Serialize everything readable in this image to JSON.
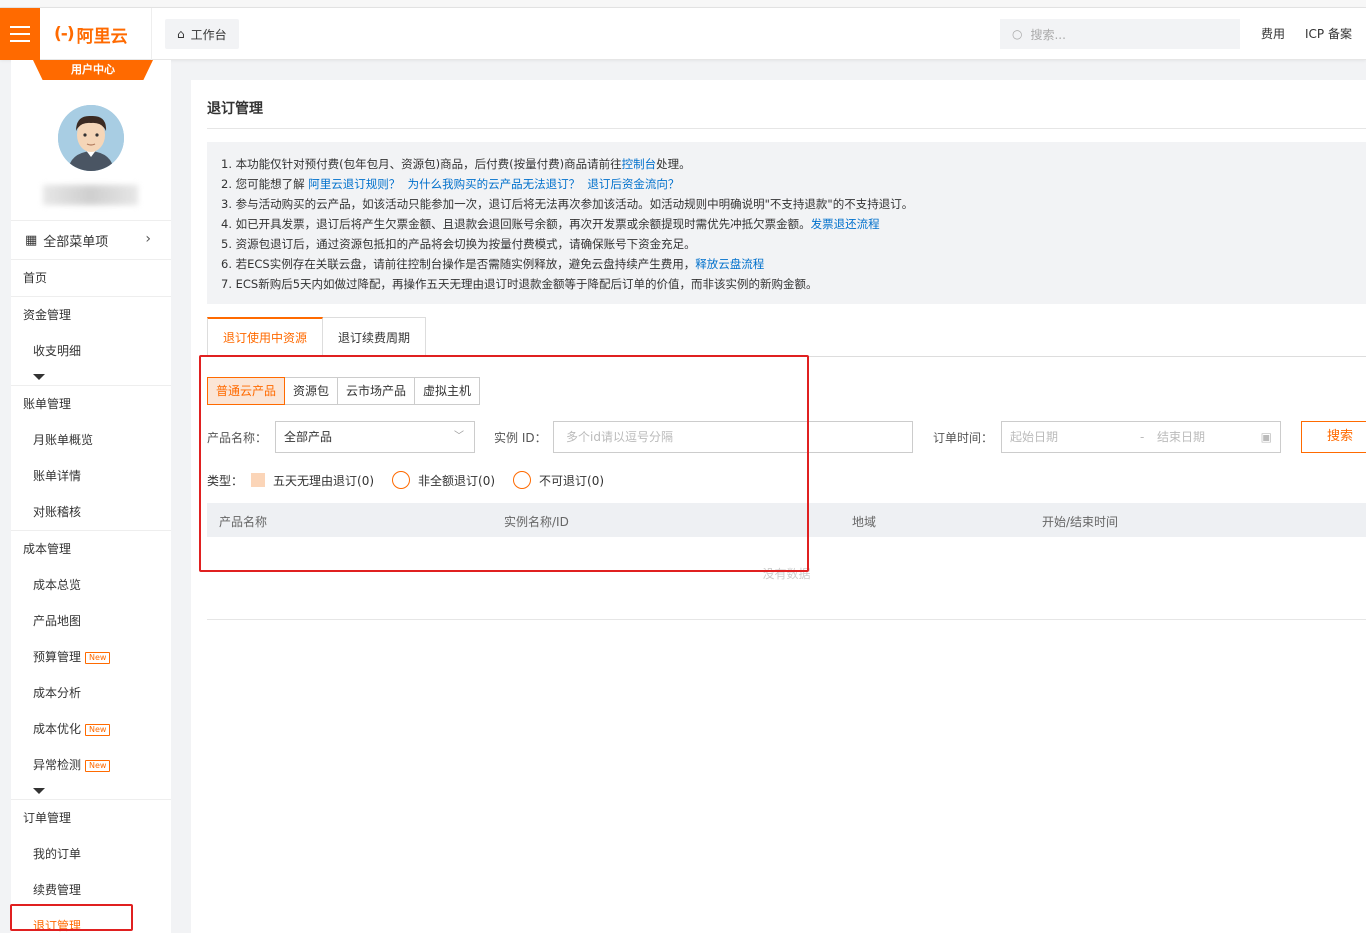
{
  "header": {
    "brand": "阿里云",
    "workbench": "工作台",
    "search_placeholder": "搜索...",
    "links": {
      "fees": "费用",
      "icp": "ICP 备案"
    }
  },
  "sidebar": {
    "badge": "用户中心",
    "all_menu": "全部菜单项",
    "home": "首页",
    "groups": {
      "funds": {
        "title": "资金管理",
        "items": [
          "收支明细"
        ]
      },
      "billing": {
        "title": "账单管理",
        "items": [
          "月账单概览",
          "账单详情",
          "对账稽核"
        ]
      },
      "cost": {
        "title": "成本管理",
        "items": [
          "成本总览",
          "产品地图",
          "预算管理",
          "成本分析",
          "成本优化",
          "异常检测"
        ]
      },
      "orders": {
        "title": "订单管理",
        "items": [
          "我的订单",
          "续费管理",
          "退订管理"
        ]
      }
    },
    "new_label": "New"
  },
  "main": {
    "title": "退订管理",
    "notice": {
      "l1_a": "1. 本功能仅针对预付费(包年包月、资源包)商品，后付费(按量付费)商品请前往",
      "l1_link": "控制台",
      "l1_b": "处理。",
      "l2_a": "2. 您可能想了解 ",
      "l2_link1": "阿里云退订规则？",
      "l2_link2": "为什么我购买的云产品无法退订？",
      "l2_link3": "退订后资金流向？",
      "l3": "3. 参与活动购买的云产品，如该活动只能参加一次，退订后将无法再次参加该活动。如活动规则中明确说明\"不支持退款\"的不支持退订。",
      "l4_a": "4. 如已开具发票，退订后将产生欠票金额、且退款会退回账号余额，再次开发票或余额提现时需优先冲抵欠票金额。",
      "l4_link": "发票退还流程",
      "l5": "5. 资源包退订后，通过资源包抵扣的产品将会切换为按量付费模式，请确保账号下资金充足。",
      "l6_a": "6. 若ECS实例存在关联云盘，请前往控制台操作是否需随实例释放，避免云盘持续产生费用，",
      "l6_link": "释放云盘流程",
      "l7": "7. ECS新购后5天内如做过降配，再操作五天无理由退订时退款金额等于降配后订单的价值，而非该实例的新购金额。"
    },
    "tabs": [
      "退订使用中资源",
      "退订续费周期"
    ],
    "subtabs": [
      "普通云产品",
      "资源包",
      "云市场产品",
      "虚拟主机"
    ],
    "filters": {
      "product_label": "产品名称：",
      "product_value": "全部产品",
      "instance_label": "实例 ID：",
      "instance_placeholder": "多个id请以逗号分隔",
      "time_label": "订单时间：",
      "start_placeholder": "起始日期",
      "end_placeholder": "结束日期",
      "search_button": "搜索"
    },
    "type": {
      "label": "类型：",
      "options": [
        "五天无理由退订(0)",
        "非全额退订(0)",
        "不可退订(0)"
      ]
    },
    "table": {
      "columns": [
        "产品名称",
        "实例名称/ID",
        "地域",
        "开始/结束时间"
      ],
      "empty": "没有数据"
    }
  },
  "colors": {
    "brand": "#ff6a00",
    "link": "#0070cc",
    "annotation": "#e02020"
  }
}
